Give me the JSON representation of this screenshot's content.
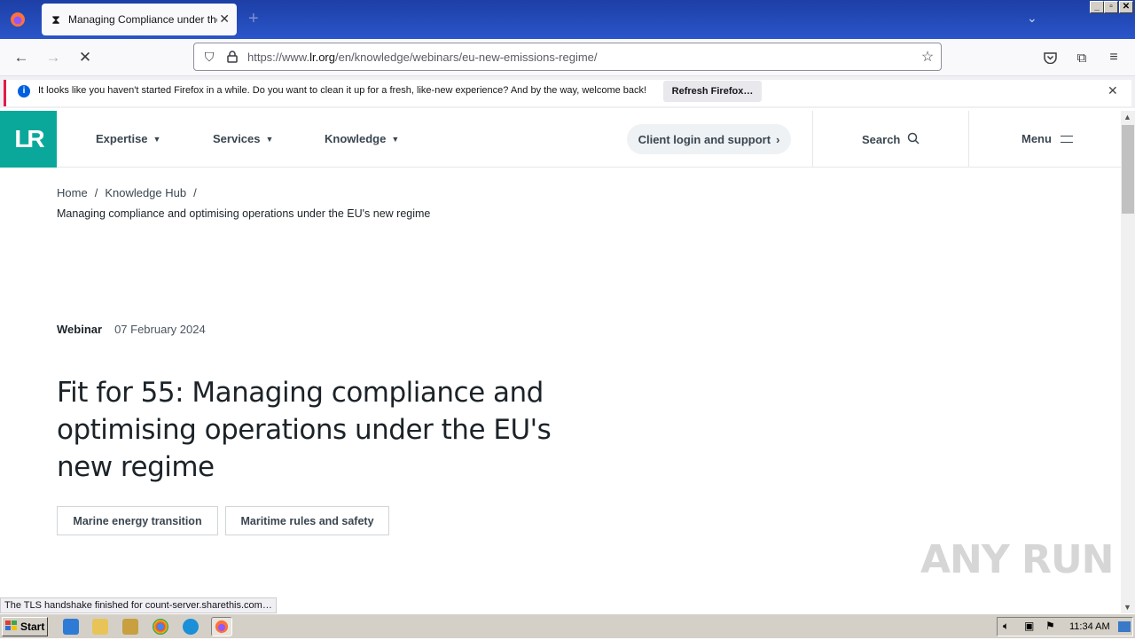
{
  "browser": {
    "tab_title": "Managing Compliance under the EU",
    "url_prefix": "https://www.",
    "url_domain": "lr.org",
    "url_path": "/en/knowledge/webinars/eu-new-emissions-regime/",
    "notification_text": "It looks like you haven't started Firefox in a while. Do you want to clean it up for a fresh, like-new experience? And by the way, welcome back!",
    "notification_button": "Refresh Firefox…",
    "status_text": "The TLS handshake finished for count-server.sharethis.com…"
  },
  "site": {
    "logo_text": "LR",
    "nav": [
      {
        "label": "Expertise"
      },
      {
        "label": "Services"
      },
      {
        "label": "Knowledge"
      }
    ],
    "client_login": "Client login and support",
    "search_label": "Search",
    "menu_label": "Menu"
  },
  "page": {
    "breadcrumb_home": "Home",
    "breadcrumb_hub": "Knowledge Hub",
    "breadcrumb_current": "Managing compliance and optimising operations under the EU's new regime",
    "content_type": "Webinar",
    "date": "07 February 2024",
    "headline": "Fit for 55: Managing compliance and optimising operations under the EU's new regime",
    "tags": [
      "Marine energy transition",
      "Maritime rules and safety"
    ]
  },
  "watermark": "ANY RUN",
  "taskbar": {
    "start_label": "Start",
    "clock": "11:34 AM"
  }
}
